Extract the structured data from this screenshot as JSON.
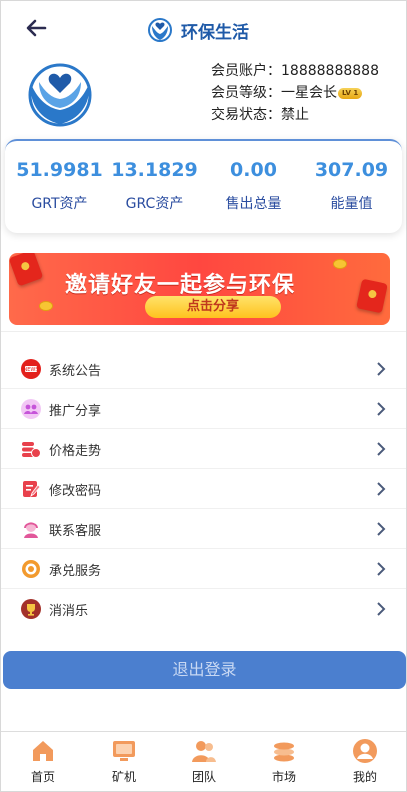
{
  "header": {
    "back_label": "",
    "title": "环保生活"
  },
  "profile": {
    "account_label": "会员账户：",
    "account_value": "18888888888",
    "level_label": "会员等级：",
    "level_value": "一星会长",
    "level_badge": "LV 1",
    "status_label": "交易状态：",
    "status_value": "禁止"
  },
  "stats": [
    {
      "value": "51.9981",
      "label": "GRT资产"
    },
    {
      "value": "13.1829",
      "label": "GRC资产"
    },
    {
      "value": "0.00",
      "label": "售出总量"
    },
    {
      "value": "307.09",
      "label": "能量值"
    }
  ],
  "banner": {
    "title": "邀请好友一起参与环保",
    "button": "点击分享"
  },
  "menu": [
    {
      "label": "系统公告",
      "icon": "announcement-icon",
      "color": "#e3211c"
    },
    {
      "label": "推广分享",
      "icon": "share-icon",
      "color": "#d06be0"
    },
    {
      "label": "价格走势",
      "icon": "price-trend-icon",
      "color": "#e8414c"
    },
    {
      "label": "修改密码",
      "icon": "edit-password-icon",
      "color": "#e8414c"
    },
    {
      "label": "联系客服",
      "icon": "customer-service-icon",
      "color": "#ef7ab5"
    },
    {
      "label": "承兑服务",
      "icon": "exchange-service-icon",
      "color": "#f29a2e"
    },
    {
      "label": "消消乐",
      "icon": "trophy-icon",
      "color": "#a3312a"
    }
  ],
  "logout_label": "退出登录",
  "tabbar": [
    {
      "label": "首页",
      "icon": "home-icon"
    },
    {
      "label": "矿机",
      "icon": "miner-icon"
    },
    {
      "label": "团队",
      "icon": "team-icon"
    },
    {
      "label": "市场",
      "icon": "market-icon"
    },
    {
      "label": "我的",
      "icon": "profile-icon"
    }
  ],
  "colors": {
    "accent": "#3d8fde",
    "stat_label": "#2b4da0",
    "logout": "#4b7fcf",
    "tab_icon": "#f08a3c"
  }
}
